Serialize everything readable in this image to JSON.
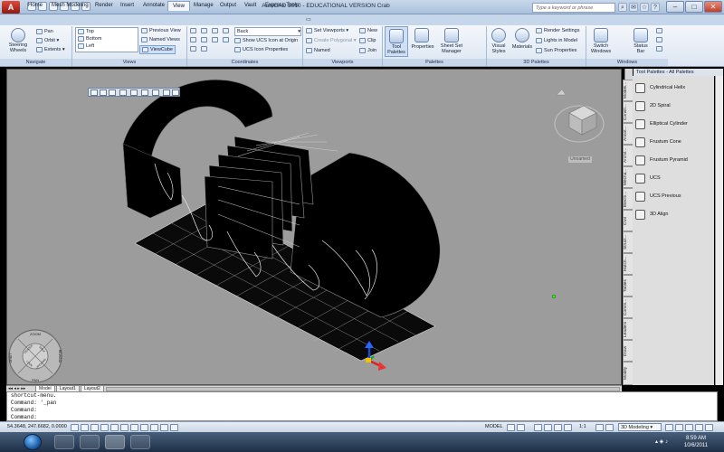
{
  "titlebar": {
    "title": "AutoCAD 2010 - EDUCATIONAL VERSION    Crab",
    "search_placeholder": "Type a keyword or phrase",
    "logo_text": "A"
  },
  "tabs": [
    "Home",
    "Mesh Modeling",
    "Render",
    "Insert",
    "Annotate",
    "View",
    "Manage",
    "Output",
    "Vault",
    "Express Tools"
  ],
  "active_tab": "View",
  "ribbon": {
    "navigate": {
      "title": "Navigate",
      "steering": "Steering\nWheels",
      "pan": "Pan",
      "orbit": "Orbit",
      "extents": "Extents"
    },
    "views": {
      "title": "Views",
      "list": [
        "Top",
        "Bottom",
        "Left"
      ],
      "previous": "Previous View",
      "named": "Named Views",
      "viewcube": "ViewCube"
    },
    "coordinates": {
      "title": "Coordinates",
      "back": "Back",
      "show_ucs": "Show UCS Icon at Origin",
      "ucs_props": "UCS Icon Properties"
    },
    "viewports": {
      "title": "Viewports",
      "set": "Set Viewports",
      "create_poly": "Create Polygonal",
      "named": "Named",
      "new": "New",
      "clip": "Clip",
      "join": "Join"
    },
    "palettes": {
      "title": "Palettes",
      "tool": "Tool\nPalettes",
      "properties": "Properties",
      "sheet": "Sheet Set\nManager"
    },
    "palettes3d": {
      "title": "3D Palettes",
      "visual": "Visual\nStyles",
      "materials": "Materials",
      "render_settings": "Render Settings",
      "lights": "Lights in Model",
      "sun": "Sun Properties"
    },
    "windows": {
      "title": "Windows",
      "switch": "Switch\nWindows",
      "status": "Status\nBar"
    }
  },
  "viewport": {
    "viewcube_label": "Unnamed",
    "wheel": {
      "zoom": "ZOOM",
      "rewind": "REWIND",
      "pan": "PAN",
      "orbit": "ORBIT",
      "center": "CENTER",
      "walk": "WALK",
      "look": "LOOK",
      "up_down": "UP/DOWN"
    }
  },
  "tool_palette": {
    "header": "Tool Palettes - All Palettes",
    "items": [
      "Cylindrical Helix",
      "2D Spiral",
      "Elliptical Cylinder",
      "Frustum Cone",
      "Frustum Pyramid",
      "UCS",
      "UCS Previous",
      "3D Align"
    ],
    "tabs": [
      "Modeli...",
      "Constr...",
      "Annot...",
      "Archit...",
      "Mecha...",
      "Electri...",
      "Civil",
      "Struct...",
      "Hatch...",
      "Tables",
      "Comm...",
      "Leaders",
      "Draw",
      "Modify"
    ]
  },
  "layout_tabs": [
    "Model",
    "Layout1",
    "Layout2"
  ],
  "command_lines": [
    "shortcut-menu.",
    "Command: '_pan",
    "Command:",
    "Command:"
  ],
  "statusbar": {
    "coords": "54.3648, 247.6682, 0.0000",
    "model": "MODEL",
    "scale": "1:1",
    "workspace": "3D Modeling"
  },
  "taskbar": {
    "time": "8:59 AM",
    "date": "10/6/2011"
  }
}
